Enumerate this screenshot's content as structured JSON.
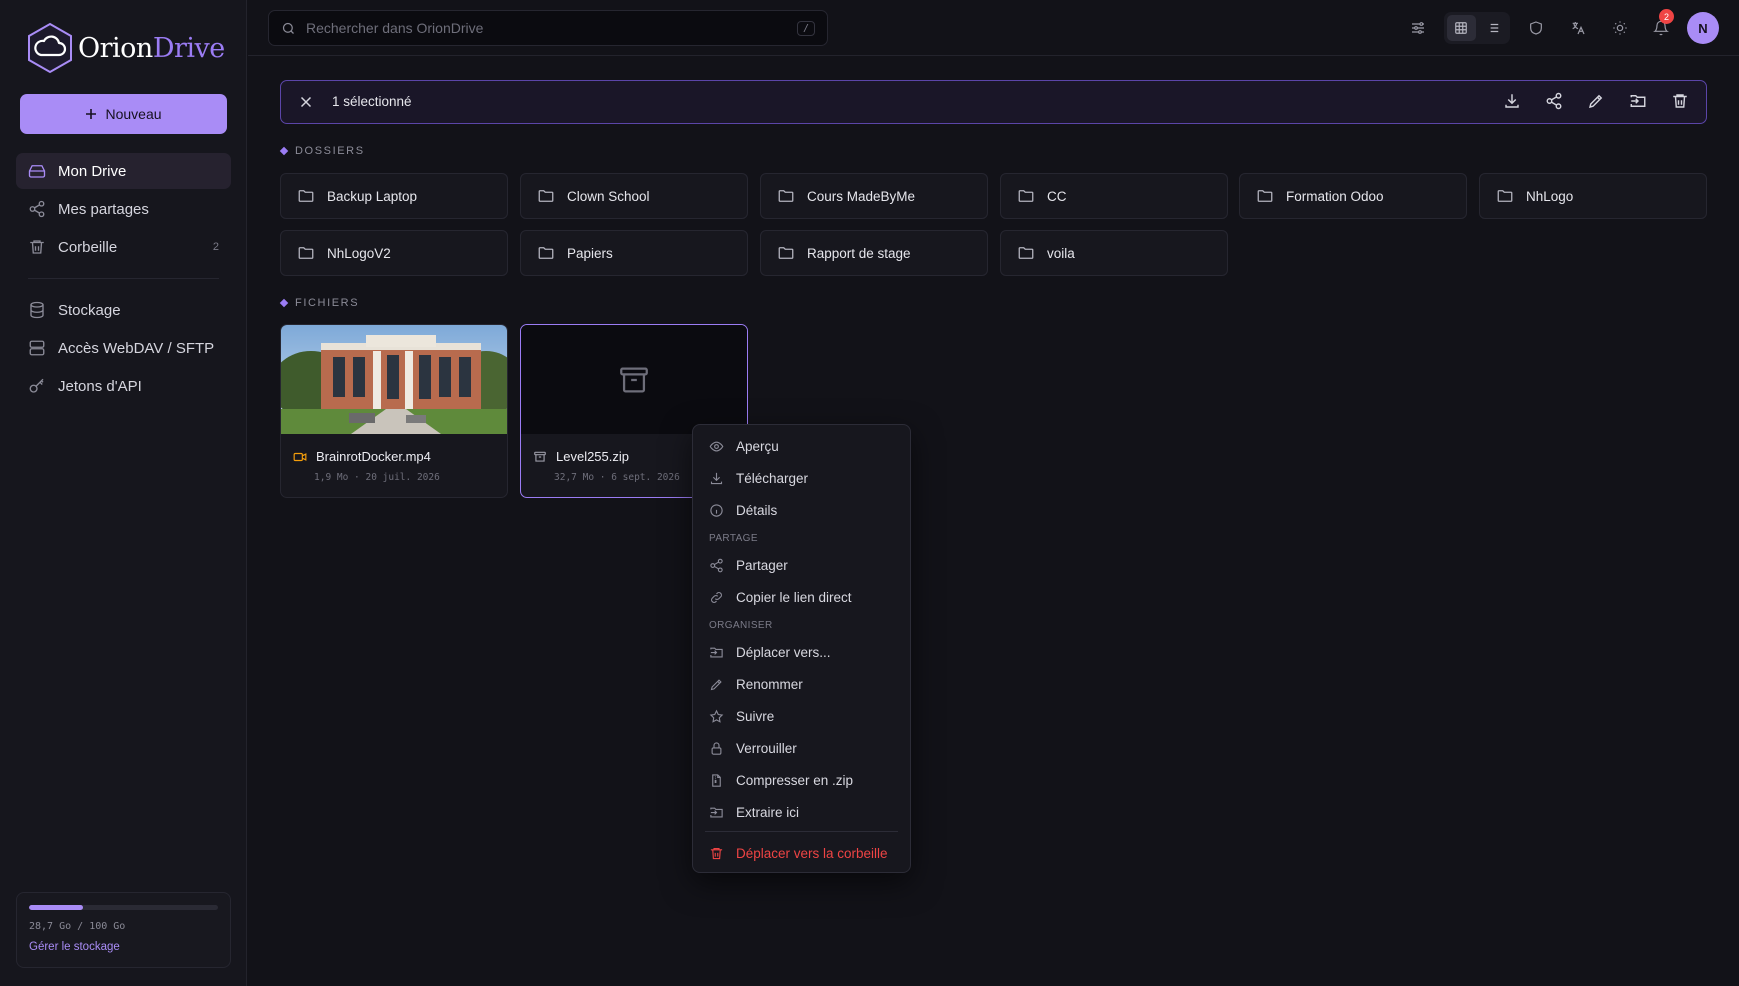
{
  "app": {
    "logo_part1": "Orion",
    "logo_part2": "Drive"
  },
  "sidebar": {
    "new_button": "Nouveau",
    "items": [
      {
        "label": "Mon Drive",
        "icon": "hard-drive-icon",
        "active": true
      },
      {
        "label": "Mes partages",
        "icon": "share-icon"
      },
      {
        "label": "Corbeille",
        "icon": "trash-icon",
        "count": "2"
      }
    ],
    "items2": [
      {
        "label": "Stockage",
        "icon": "database-icon"
      },
      {
        "label": "Accès WebDAV / SFTP",
        "icon": "server-icon"
      },
      {
        "label": "Jetons d'API",
        "icon": "key-icon"
      }
    ],
    "storage": {
      "text": "28,7 Go / 100 Go",
      "used_fraction": 0.287,
      "link": "Gérer le stockage"
    }
  },
  "topbar": {
    "search_placeholder": "Rechercher dans OrionDrive",
    "search_shortcut": "/",
    "notification_count": "2",
    "avatar_initial": "N"
  },
  "selection": {
    "text": "1 sélectionné"
  },
  "sections": {
    "folders": "DOSSIERS",
    "files": "FICHIERS"
  },
  "folders": [
    "Backup Laptop",
    "Clown School",
    "Cours MadeByMe",
    "CC",
    "Formation Odoo",
    "NhLogo",
    "NhLogoV2",
    "Papiers",
    "Rapport de stage",
    "voila"
  ],
  "files": [
    {
      "name": "BrainrotDocker.mp4",
      "meta": "1,9 Mo · 20 juil. 2026",
      "icon": "video-icon"
    },
    {
      "name": "Level255.zip",
      "meta": "32,7 Mo · 6 sept. 2026",
      "icon": "archive-icon",
      "selected": true
    }
  ],
  "context_menu": {
    "items_top": [
      "Aperçu",
      "Télécharger",
      "Détails"
    ],
    "label_share": "PARTAGE",
    "items_share": [
      "Partager",
      "Copier le lien direct"
    ],
    "label_organize": "ORGANISER",
    "items_organize": [
      "Déplacer vers...",
      "Renommer",
      "Suivre",
      "Verrouiller",
      "Compresser en .zip",
      "Extraire ici"
    ],
    "danger": "Déplacer vers la corbeille"
  },
  "colors": {
    "accent": "#a98cf6",
    "danger": "#ef4444",
    "background": "#121218"
  }
}
